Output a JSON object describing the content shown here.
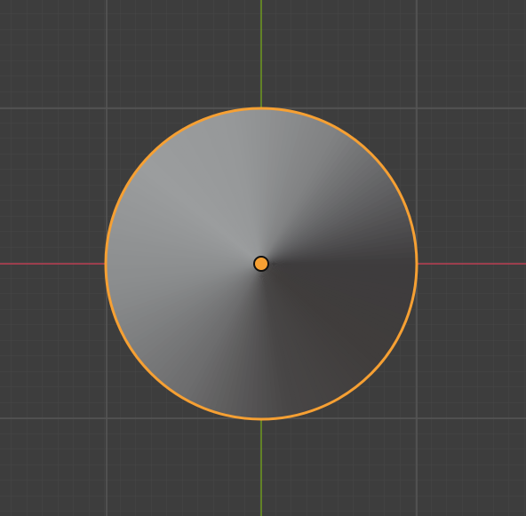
{
  "viewport": {
    "view": "top-orthographic",
    "background_color": "#3d3d3d",
    "grid": {
      "minor_line_color": "#454545",
      "major_line_color": "#545454",
      "visible": true
    },
    "axes": {
      "x_axis_color": "#bb3e53",
      "y_axis_color": "#6f9a1e"
    }
  },
  "scene": {
    "selected_object": {
      "icon": "cone-icon",
      "shape": "cone",
      "selected": true,
      "selection_outline_color": "#f6a033",
      "shading": "solid-studio"
    },
    "origin_point": {
      "icon": "object-origin-icon",
      "fill_color": "#f6a033",
      "stroke_color": "#111111"
    }
  }
}
